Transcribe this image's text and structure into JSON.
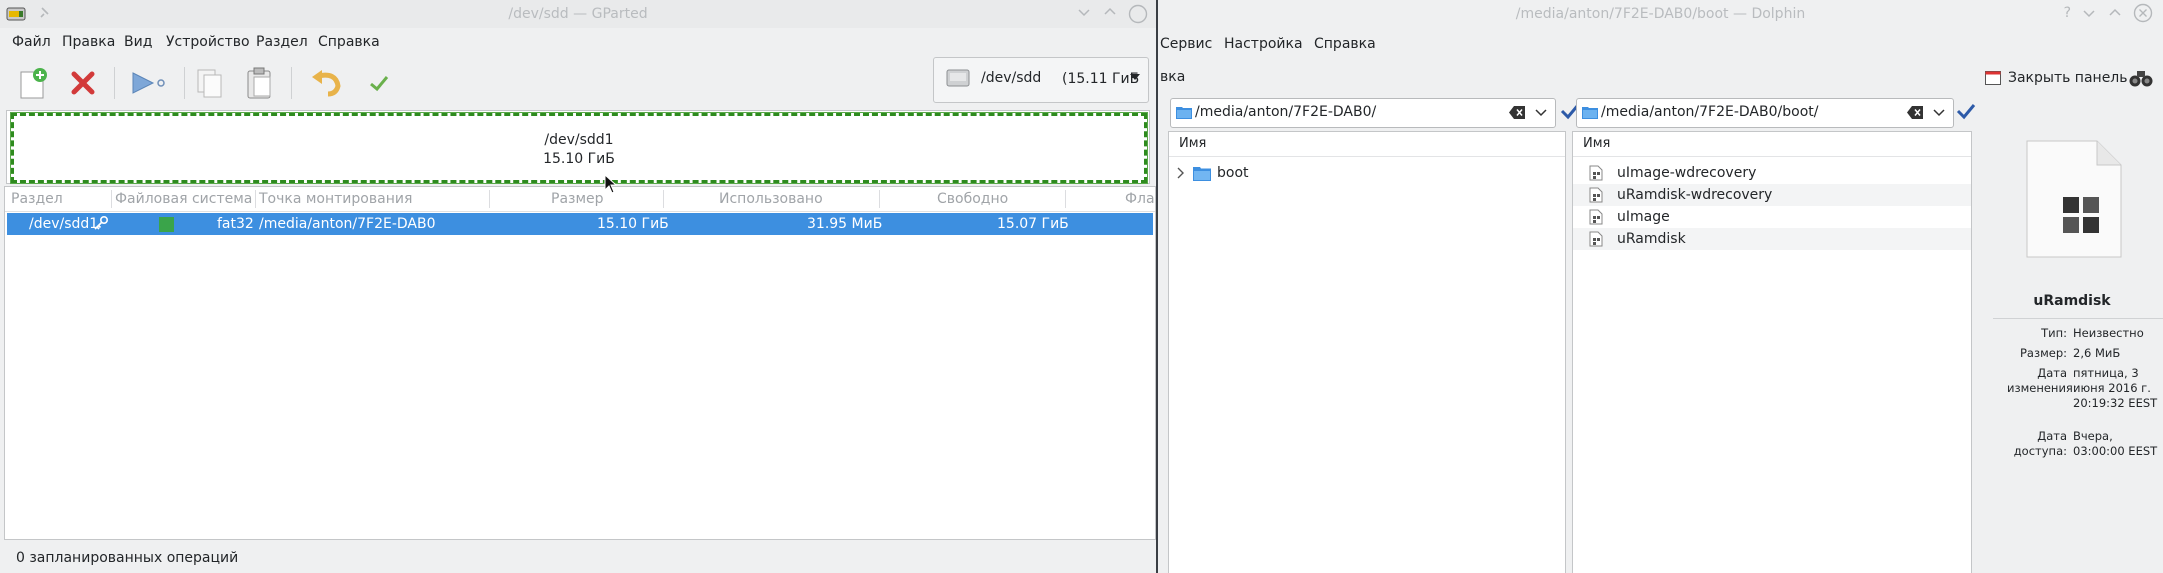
{
  "gparted": {
    "title": "/dev/sdd — GParted",
    "menu": [
      "Файл",
      "Правка",
      "Вид",
      "Устройство",
      "Раздел",
      "Справка"
    ],
    "device": {
      "name": "/dev/sdd",
      "size": "(15.11 ГиБ"
    },
    "disk_map": {
      "partition": "/dev/sdd1",
      "size": "15.10 ГиБ"
    },
    "table": {
      "headers": [
        "Раздел",
        "Файловая система",
        "Точка монтирования",
        "Размер",
        "Использовано",
        "Свободно",
        "Фла"
      ],
      "rows": [
        {
          "partition": "/dev/sdd1",
          "filesystem": "fat32",
          "fs_color": "#3aa44a",
          "mountpoint": "/media/anton/7F2E-DAB0",
          "size": "15.10 ГиБ",
          "used": "31.95 МиБ",
          "free": "15.07 ГиБ"
        }
      ]
    },
    "status": "0 запланированных операций"
  },
  "dolphin": {
    "title": "/media/anton/7F2E-DAB0/boot — Dolphin",
    "menu": [
      "Сервис",
      "Настройка",
      "Справка"
    ],
    "toolbar_partial_label": "вка",
    "close_panel_label": "Закрыть панель",
    "left_pane": {
      "path": "/media/anton/7F2E-DAB0/",
      "column": "Имя",
      "items": [
        {
          "name": "boot",
          "type": "folder"
        }
      ]
    },
    "right_pane": {
      "path": "/media/anton/7F2E-DAB0/boot/",
      "column": "Имя",
      "items": [
        {
          "name": "uImage-wdrecovery"
        },
        {
          "name": "uRamdisk-wdrecovery"
        },
        {
          "name": "uImage"
        },
        {
          "name": "uRamdisk"
        }
      ]
    },
    "info": {
      "name": "uRamdisk",
      "type_label": "Тип:",
      "type_value": "Неизвестно",
      "size_label": "Размер:",
      "size_value": "2,6 МиБ",
      "modified_label": "Дата изменения:",
      "modified_value": "пятница, 3 июня 2016 г. 20:19:32 EEST",
      "accessed_label": "Дата доступа:",
      "accessed_value": "Вчера, 03:00:00 EEST"
    }
  },
  "colors": {
    "selection": "#3d8fe0",
    "partition_border": "#2e8b1e",
    "accent": "#3daee9"
  }
}
